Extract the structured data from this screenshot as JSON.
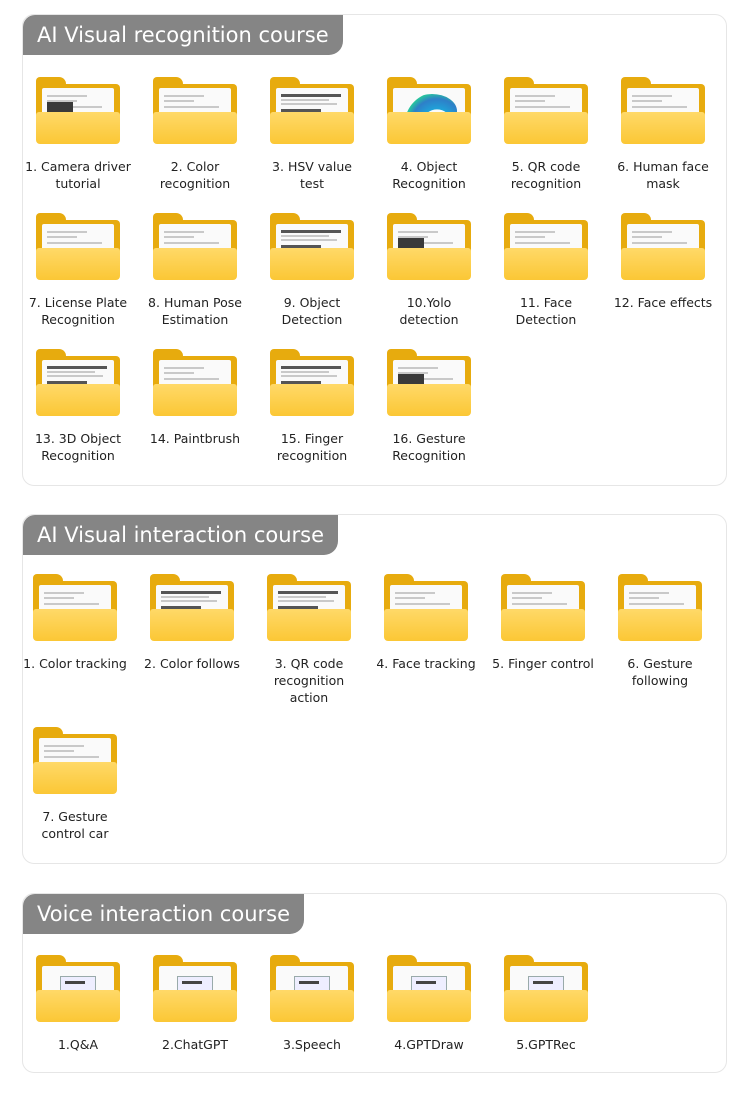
{
  "sections": [
    {
      "title": "AI Visual recognition course",
      "items": [
        {
          "label": "1. Camera driver tutorial",
          "thumb": "doc-photo"
        },
        {
          "label": "2. Color recognition",
          "thumb": "doc"
        },
        {
          "label": "3. HSV value test",
          "thumb": "doc-heavy"
        },
        {
          "label": "4. Object Recognition",
          "thumb": "wave"
        },
        {
          "label": "5. QR code recognition",
          "thumb": "doc"
        },
        {
          "label": "6. Human face mask",
          "thumb": "doc"
        },
        {
          "label": "7. License Plate Recognition",
          "thumb": "doc"
        },
        {
          "label": "8. Human Pose Estimation",
          "thumb": "doc"
        },
        {
          "label": "9. Object Detection",
          "thumb": "doc-heavy"
        },
        {
          "label": "10.Yolo detection",
          "thumb": "doc-photo"
        },
        {
          "label": "11. Face Detection",
          "thumb": "doc"
        },
        {
          "label": "12. Face effects",
          "thumb": "doc"
        },
        {
          "label": "13. 3D Object Recognition",
          "thumb": "doc-heavy"
        },
        {
          "label": "14. Paintbrush",
          "thumb": "doc-red"
        },
        {
          "label": "15. Finger recognition",
          "thumb": "doc-heavy"
        },
        {
          "label": "16. Gesture Recognition",
          "thumb": "doc-photo"
        }
      ]
    },
    {
      "title": "AI Visual interaction course",
      "items": [
        {
          "label": "1. Color tracking",
          "thumb": "doc"
        },
        {
          "label": "2. Color follows",
          "thumb": "doc-heavy"
        },
        {
          "label": "3. QR code recognition action",
          "thumb": "doc-heavy"
        },
        {
          "label": "4. Face tracking",
          "thumb": "doc"
        },
        {
          "label": "5. Finger control",
          "thumb": "doc"
        },
        {
          "label": "6. Gesture following",
          "thumb": "doc"
        },
        {
          "label": "7. Gesture control car",
          "thumb": "doc"
        }
      ]
    },
    {
      "title": "Voice interaction course",
      "items": [
        {
          "label": "1.Q&A",
          "thumb": "card"
        },
        {
          "label": "2.ChatGPT",
          "thumb": "card"
        },
        {
          "label": "3.Speech",
          "thumb": "card"
        },
        {
          "label": "4.GPTDraw",
          "thumb": "card"
        },
        {
          "label": "5.GPTRec",
          "thumb": "card"
        }
      ]
    }
  ]
}
